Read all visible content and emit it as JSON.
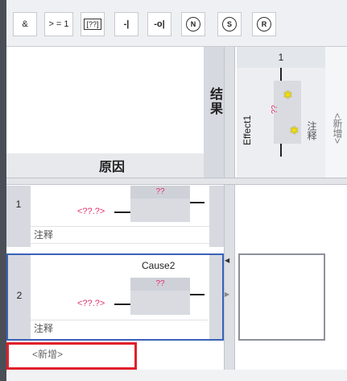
{
  "toolbar": {
    "buttons": [
      {
        "label": "&"
      },
      {
        "label": "> = 1"
      },
      {
        "label": "[??]"
      },
      {
        "label": "-|"
      },
      {
        "label": "-o|"
      },
      {
        "label": "N"
      },
      {
        "label": "S"
      },
      {
        "label": "R"
      }
    ]
  },
  "header": {
    "result_label": "结果",
    "cause_label": "原因",
    "effect": {
      "index": "1",
      "name": "Effect1",
      "block_text": "??",
      "comment": "注释",
      "new": "<新增>"
    }
  },
  "rows": [
    {
      "index": "1",
      "input_label": "<??.?>",
      "block_text": "??",
      "comment": "注释"
    },
    {
      "index": "2",
      "name": "Cause2",
      "input_label": "<??.?>",
      "block_text": "??",
      "comment": "注释"
    }
  ],
  "new_row": "<新增>"
}
